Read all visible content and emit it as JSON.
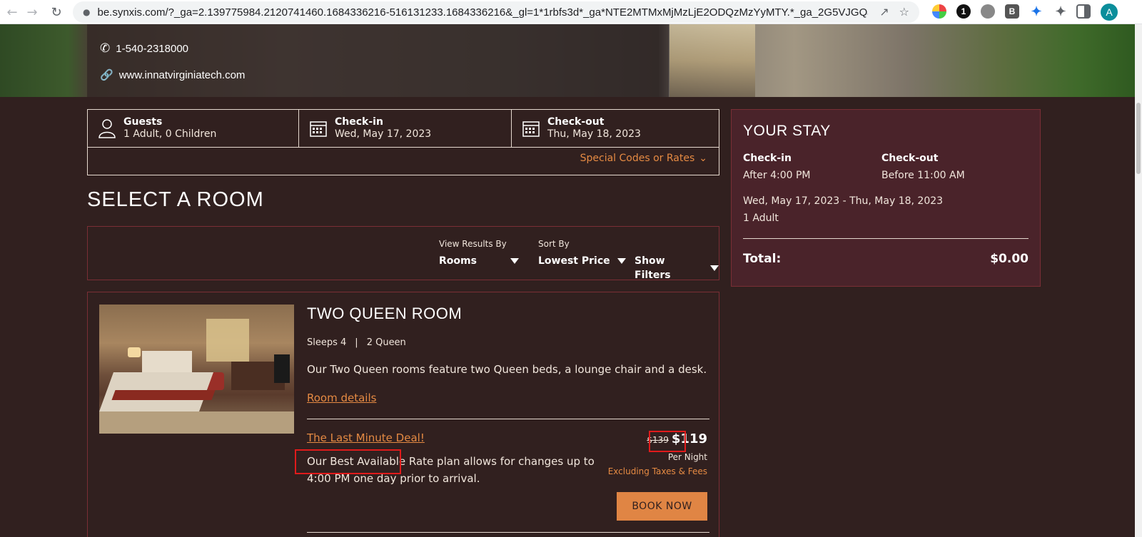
{
  "browser": {
    "url": "be.synxis.com/?_ga=2.139775984.2120741460.1684336216-516131233.1684336216&_gl=1*1rbfs3d*_ga*NTE2MTMxMjMzLjE2ODQzMzYyMTY.*_ga_2G5VJGQJF4*MT...",
    "profile_initial": "A",
    "extensions": [
      "color-picker-icon",
      "1password-icon",
      "globe-icon",
      "b-extension-icon",
      "puzzle-blue-icon",
      "extensions-icon",
      "sidebar-icon"
    ]
  },
  "hotel": {
    "phone": "1-540-2318000",
    "website": "www.innatvirginiatech.com"
  },
  "search": {
    "guests_label": "Guests",
    "guests_value": "1 Adult, 0 Children",
    "checkin_label": "Check-in",
    "checkin_value": "Wed, May 17, 2023",
    "checkout_label": "Check-out",
    "checkout_value": "Thu, May 18, 2023",
    "special_codes": "Special Codes or Rates"
  },
  "section_title": "SELECT A ROOM",
  "filters": {
    "view_label": "View Results By",
    "view_value": "Rooms",
    "sort_label": "Sort By",
    "sort_value": "Lowest Price",
    "show_filters": "Show Filters"
  },
  "room": {
    "name": "TWO QUEEN ROOM",
    "sleeps": "Sleeps 4",
    "beds": "2 Queen",
    "separator": "|",
    "description": "Our Two Queen rooms feature two Queen beds, a lounge chair and a desk.",
    "details_link": "Room details",
    "rate_name": "The Last Minute Deal!",
    "rate_description": "Our Best Available Rate plan allows for changes up to 4:00 PM one day prior to arrival.",
    "old_price": "$139",
    "new_price": "$119",
    "per_night": "Per Night",
    "taxes_note": "Excluding Taxes & Fees",
    "book_label": "BOOK NOW"
  },
  "stay": {
    "title": "YOUR STAY",
    "checkin_label": "Check-in",
    "checkin_value": "After 4:00 PM",
    "checkout_label": "Check-out",
    "checkout_value": "Before 11:00 AM",
    "dates": "Wed, May 17, 2023 - Thu, May 18, 2023",
    "guests": "1 Adult",
    "total_label": "Total:",
    "total_value": "$0.00"
  },
  "colors": {
    "background": "#31201f",
    "accent": "#e58a43",
    "stay_panel": "#4a232a",
    "highlight": "#e01b1b"
  }
}
